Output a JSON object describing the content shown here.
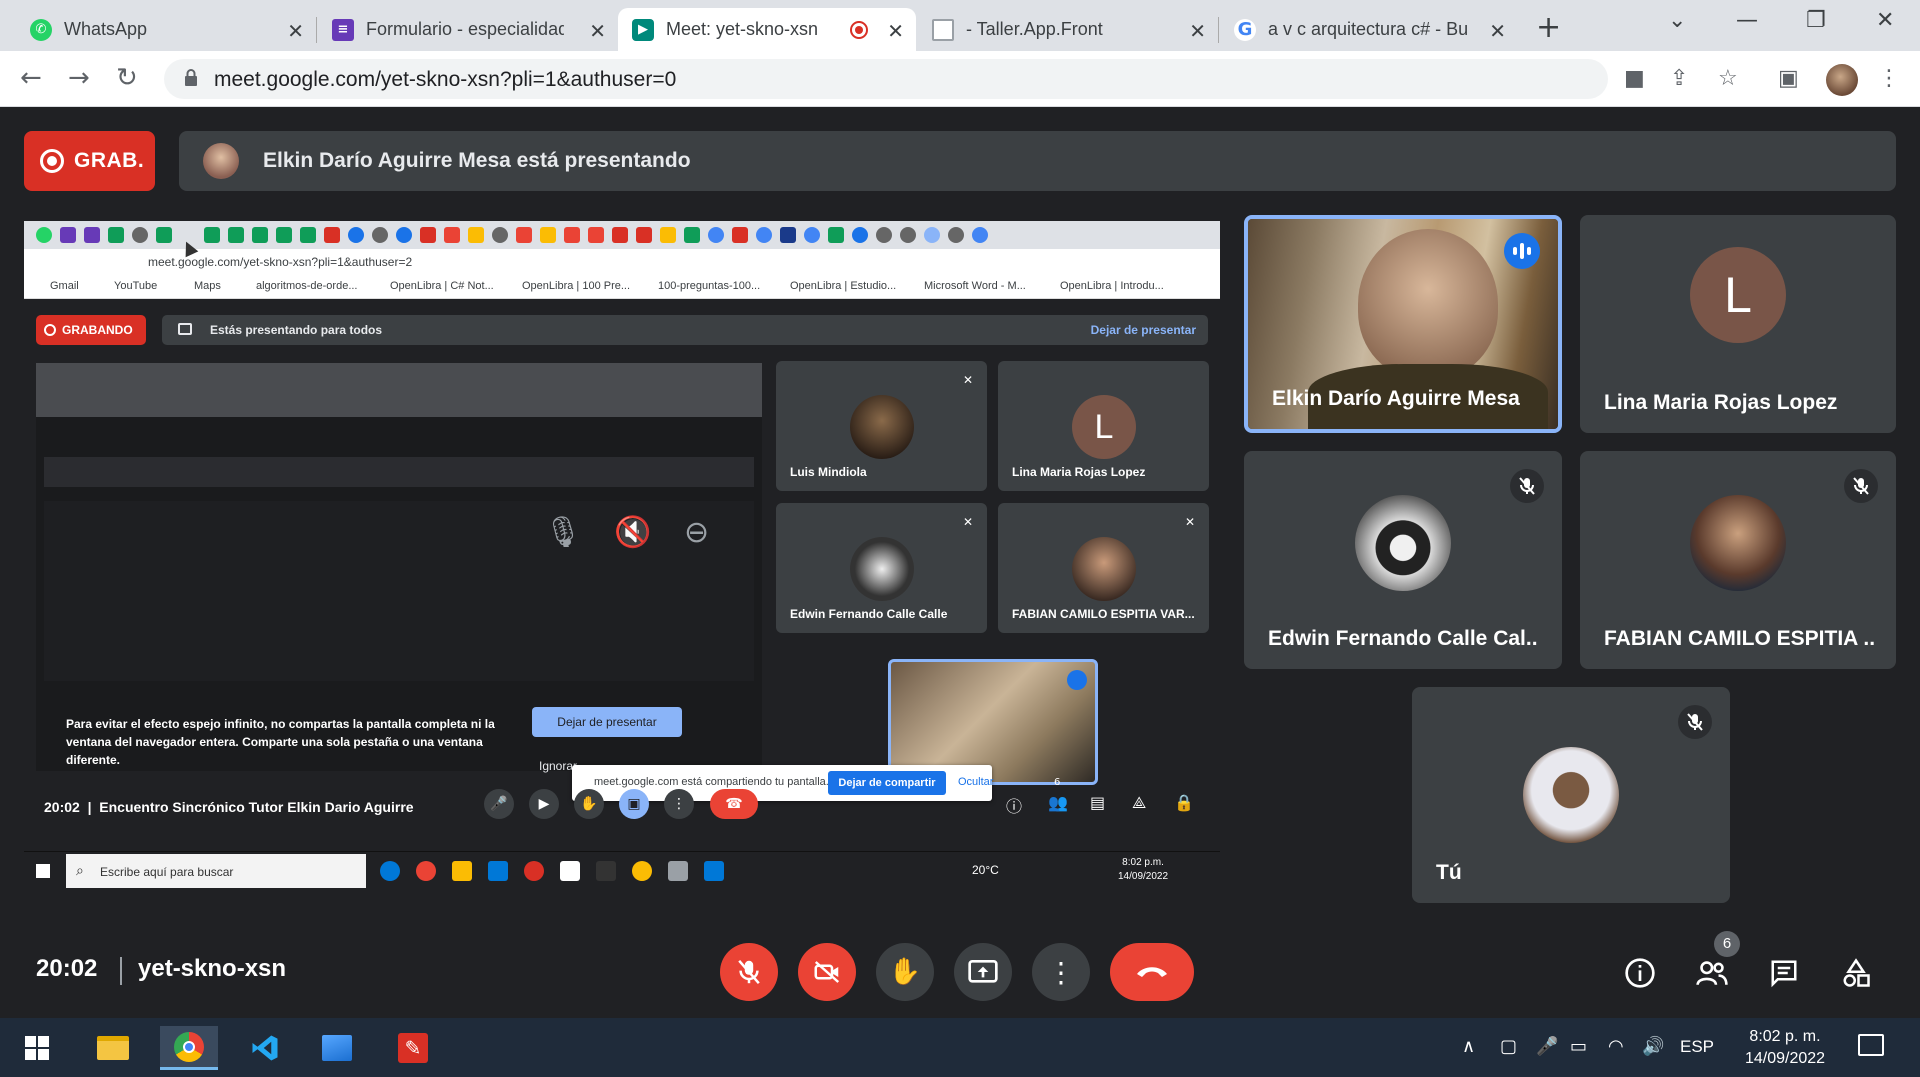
{
  "browser": {
    "tabs": [
      {
        "title": "WhatsApp",
        "icon": "whatsapp-icon",
        "color": "#25d366"
      },
      {
        "title": "Formulario - especialidad",
        "icon": "forms-icon",
        "color": "#673ab7"
      },
      {
        "title": "Meet: yet-skno-xsn",
        "icon": "meet-icon",
        "color": "#00897b"
      },
      {
        "title": "- Taller.App.Front",
        "icon": "doc-icon",
        "color": "#9aa0a6"
      },
      {
        "title": "a v c arquitectura c# - Bus",
        "icon": "google-icon",
        "color": "#4285f4"
      }
    ],
    "url": "meet.google.com/yet-skno-xsn?pli=1&authuser=0"
  },
  "meet": {
    "rec_label": "GRAB.",
    "presenter_text": "Elkin Darío Aguirre Mesa está presentando",
    "clock": "20:02",
    "meeting_code": "yet-skno-xsn",
    "participant_count": "6"
  },
  "shared": {
    "url": "meet.google.com/yet-skno-xsn?pli=1&authuser=2",
    "bookmarks": [
      "Gmail",
      "YouTube",
      "Maps",
      "algoritmos-de-orde...",
      "OpenLibra | C# Not...",
      "OpenLibra | 100 Pre...",
      "100-preguntas-100...",
      "OpenLibra | Estudio...",
      "Microsoft Word - M...",
      "OpenLibra | Introdu..."
    ],
    "rec_label": "GRABANDO",
    "presenting_text": "Estás presentando para todos",
    "stop_presenting": "Dejar de presentar",
    "tiles": [
      {
        "name": "Luis Mindiola",
        "avatar": "photo"
      },
      {
        "name": "Lina Maria Rojas Lopez",
        "avatar": "L"
      },
      {
        "name": "Edwin Fernando Calle Calle",
        "avatar": "chess"
      },
      {
        "name": "FABIAN CAMILO ESPITIA VAR...",
        "avatar": "photo"
      }
    ],
    "warning": "Para evitar el efecto espejo infinito, no compartas la pantalla completa ni la ventana del navegador entera. Comparte una sola pestaña o una ventana diferente.",
    "stop_btn": "Dejar de presentar",
    "ignore": "Ignorar",
    "sharing_text": "meet.google.com está compartiendo tu pantalla.",
    "stop_sharing": "Dejar de compartir",
    "hide": "Ocultar",
    "time": "20:02",
    "meeting_title": "Encuentro Sincrónico Tutor Elkin Dario Aguirre",
    "participant_count": "6",
    "taskbar_search": "Escribe aquí para buscar",
    "weather": "20°C",
    "taskbar_time": "8:02 p.m.",
    "taskbar_date": "14/09/2022"
  },
  "participants": [
    {
      "name": "Elkin Darío Aguirre Mesa",
      "speaking": true
    },
    {
      "name": "Lina Maria Rojas Lopez",
      "initial": "L",
      "color": "#795548"
    },
    {
      "name": "Edwin Fernando Calle Cal...",
      "muted": true
    },
    {
      "name": "FABIAN CAMILO ESPITIA ...",
      "muted": true
    },
    {
      "name": "Tú",
      "muted": true
    }
  ],
  "taskbar": {
    "lang": "ESP",
    "time": "8:02 p. m.",
    "date": "14/09/2022"
  },
  "colors": {
    "meet_bg": "#202124",
    "tile_bg": "#3c4043",
    "red": "#ea4335",
    "accent_blue": "#8ab4f8"
  }
}
